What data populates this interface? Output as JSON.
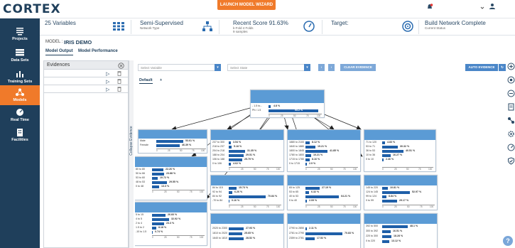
{
  "app": {
    "logo": "CORTEX",
    "wizard_label": "LAUNCH MODEL WIZARD"
  },
  "sidebar": {
    "items": [
      {
        "label": "Projects",
        "icon": "projects-icon"
      },
      {
        "label": "Data Sets",
        "icon": "datasets-icon"
      },
      {
        "label": "Training Sets",
        "icon": "training-sets-icon"
      },
      {
        "label": "Models",
        "icon": "models-icon",
        "active": true
      },
      {
        "label": "Real Time",
        "icon": "real-time-icon"
      },
      {
        "label": "Facilities",
        "icon": "facilities-icon"
      }
    ]
  },
  "info": {
    "variables": "25 Variables",
    "network_type": "Semi-Supervised",
    "network_type_sub": "Network Type",
    "recent_score": "Recent Score 91.63%",
    "recent_score_sub1": "k-Fold 4 Folds",
    "recent_score_sub2": "9 samples",
    "target": "Target:",
    "build": "Build Network Complete",
    "build_sub": "Current Status"
  },
  "model": {
    "label": "MODEL :",
    "name": "IRIS DEMO",
    "tabs": [
      "Model Output",
      "Model Performance"
    ]
  },
  "evidences": {
    "title": "Evidences",
    "rows": 3
  },
  "collapse_label": "Collapse Evidence",
  "toolbar": {
    "select_variable": "Select Variable",
    "select_state": "Select State",
    "clear_evidence": "CLEAR EVIDENCE",
    "auto_evidence": "AUTO EVIDENCE"
  },
  "graph_tabs": {
    "default": "Default",
    "add": "+"
  },
  "nodes": {
    "top": {
      "rows": [
        [
          "- 1.5 to...",
          "4.8 %",
          4.8
        ],
        [
          "Ph i 1.5",
          "95.2 %",
          95.2
        ]
      ]
    },
    "n1": {
      "rows": [
        [
          "Male",
          "53.61 %",
          53.61
        ],
        [
          "Female",
          "46.39 %",
          46.39
        ]
      ]
    },
    "n2": {
      "rows": [
        [
          "237 to 300",
          "3.54 %",
          3.54
        ],
        [
          "218 to 237",
          "5.18 %",
          5.18
        ],
        [
          "204 to 218",
          "31.35 %",
          31.35
        ],
        [
          "188 to 204",
          "29.51 %",
          29.51
        ],
        [
          "106 to 188",
          "25.79 %",
          25.79
        ],
        [
          "0 to 106",
          "4.62 %",
          4.62
        ]
      ]
    },
    "n3": {
      "rows": [
        [
          "1880 to 2100",
          "8.12 %",
          8.12
        ],
        [
          "1840 to 1880",
          "19.21 %",
          19.21
        ],
        [
          "1800 to 1845",
          "41.85 %",
          41.85
        ],
        [
          "1780 to 1800",
          "10.21 %",
          10.21
        ],
        [
          "1715 to 1780",
          "8.16 %",
          8.16
        ],
        [
          "0 to 1715",
          "2.9 %",
          2.9
        ]
      ]
    },
    "n4": {
      "rows": [
        [
          "71 to 120",
          "4.83 %",
          4.83
        ],
        [
          "53 to 71",
          "30.32 %",
          30.32
        ],
        [
          "36 to 53",
          "40.51 %",
          40.51
        ],
        [
          "10 to 36",
          "16.27 %",
          16.27
        ],
        [
          "0 to 10",
          "2.46 %",
          2.46
        ]
      ]
    },
    "n5": {
      "rows": [
        [
          "80 to 80",
          "22.26 %",
          22.26
        ],
        [
          "50 to 66",
          "23.88 %",
          23.88
        ],
        [
          "53 to 60",
          "10.72 %",
          10.72
        ],
        [
          "48 to 53",
          "29.55 %",
          29.55
        ],
        [
          "0 to 48",
          "13.3 %",
          13.3
        ]
      ]
    },
    "n6": {
      "rows": [
        [
          "84 to 115",
          "15.73 %",
          15.73
        ],
        [
          "92 to 94",
          "6.26 %",
          6.26
        ],
        [
          "84 to 92",
          "70.84 %",
          70.84
        ],
        [
          "-70 to 84",
          "0.16 %",
          0.16
        ]
      ]
    },
    "n7": {
      "rows": [
        [
          "65 to 125",
          "27.19 %",
          27.19
        ],
        [
          "53 to 65",
          "6.32 %",
          6.32
        ],
        [
          "40 to 53",
          "64.21 %",
          64.21
        ],
        [
          "0 to 40",
          "2.09 %",
          2.09
        ]
      ]
    },
    "n8": {
      "rows": [
        [
          "145 to 220",
          "10.81 %",
          10.81
        ],
        [
          "124 to 145",
          "52.97 %",
          52.97
        ],
        [
          "99 to 124",
          "8.84 %",
          8.84
        ],
        [
          "0 to 99",
          "29.17 %",
          29.17
        ]
      ]
    },
    "n9": {
      "rows": [
        [
          "5 to 15",
          "26.83 %",
          26.83
        ],
        [
          "4 to 5",
          "32.92 %",
          32.92
        ],
        [
          "2 to 4",
          "23.3 %",
          23.3
        ],
        [
          "1.5 to 2",
          "8.18 %",
          8.18
        ],
        [
          "-10 to 1.5",
          "0.74 %",
          0.74
        ]
      ]
    },
    "n10": {
      "rows": [
        [
          "2020 to 2300",
          "27.93 %",
          27.93
        ],
        [
          "1810 to 2020",
          "25.65 %",
          25.65
        ],
        [
          "1640 to 1810",
          "28.52 %",
          28.52
        ]
      ]
    },
    "n11": {
      "rows": [
        [
          "2790 to 2850",
          "2.11 %",
          2.11
        ],
        [
          "2781 to 2790",
          "70.83 %",
          70.83
        ],
        [
          "2359 to 2781",
          "17.52 %",
          17.52
        ]
      ]
    },
    "n12": {
      "rows": [
        [
          "392 to 500",
          "48.1 %",
          48.1
        ],
        [
          "300 to 392",
          "16.51 %",
          16.51
        ],
        [
          "220 to 300",
          "18.28 %",
          18.28
        ],
        [
          "0 to 220",
          "13.12 %",
          13.12
        ]
      ]
    }
  },
  "axis_ticks": [
    "0",
    "25",
    "50",
    "75",
    "100"
  ]
}
